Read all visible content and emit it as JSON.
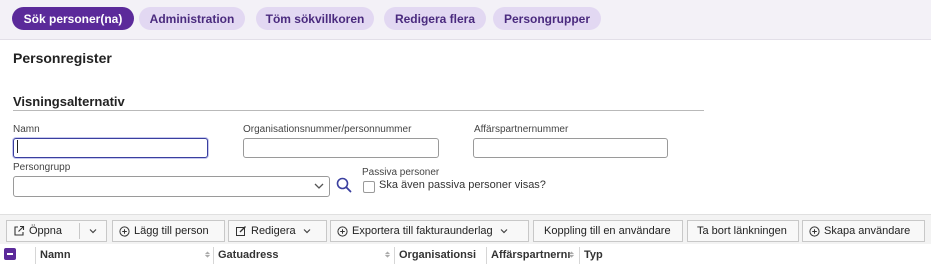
{
  "topbar": {
    "search_label": "Sök personer(na)",
    "admin_label": "Administration",
    "clear_label": "Töm sökvillkoren",
    "edit_many_label": "Redigera flera",
    "groups_label": "Persongrupper"
  },
  "page": {
    "title": "Personregister",
    "section_title": "Visningsalternativ"
  },
  "form": {
    "name_label": "Namn",
    "name_value": "",
    "orgnr_label": "Organisationsnummer/personnummer",
    "orgnr_value": "",
    "partner_label": "Affärspartnernummer",
    "partner_value": "",
    "group_label": "Persongrupp",
    "group_value": "",
    "passive_label": "Passiva personer",
    "passive_checkbox_label": "Ska även passiva personer visas?",
    "passive_checked": false
  },
  "toolbar": {
    "open_label": "Öppna",
    "add_label": "Lägg till person",
    "edit_label": "Redigera",
    "export_label": "Exportera till fakturaunderlag",
    "link_label": "Koppling till en användare",
    "unlink_label": "Ta bort länkningen",
    "create_user_label": "Skapa användare"
  },
  "table": {
    "columns": [
      "Namn",
      "Gatuadress",
      "Organisationsi",
      "Affärspartnernı",
      "Typ"
    ]
  },
  "colors": {
    "primary": "#5b2a9a",
    "secondary_pill": "#e2d8f2",
    "topbar_bg": "#f3f1f7"
  }
}
